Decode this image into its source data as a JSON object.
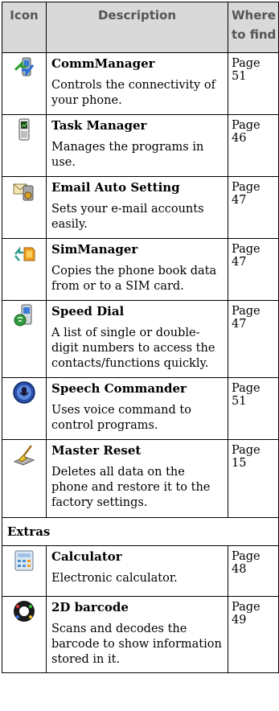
{
  "header": {
    "icon": "Icon",
    "description": "Description",
    "where": "Where to find"
  },
  "rows": [
    {
      "title": "CommManager",
      "desc": "Controls the connectivity of your phone.",
      "page": "Page 51",
      "icon": "comm-manager-icon"
    },
    {
      "title": "Task Manager",
      "desc": "Manages the programs in use.",
      "page": "Page 46",
      "icon": "task-manager-icon"
    },
    {
      "title": "Email Auto Setting",
      "desc": "Sets your e-mail accounts easily.",
      "page": "Page 47",
      "icon": "email-auto-setting-icon"
    },
    {
      "title": "SimManager",
      "desc": "Copies the phone book data from or to a SIM card.",
      "page": "Page 47",
      "icon": "sim-manager-icon"
    },
    {
      "title": "Speed Dial",
      "desc": "A list of single or double-digit numbers to access the contacts/functions quickly.",
      "page": "Page 47",
      "icon": "speed-dial-icon"
    },
    {
      "title": "Speech Commander",
      "desc": "Uses voice command to control programs.",
      "page": "Page 51",
      "icon": "speech-commander-icon"
    },
    {
      "title": "Master Reset",
      "desc": "Deletes all data on the phone and restore it to the factory settings.",
      "page": "Page 15",
      "icon": "master-reset-icon"
    }
  ],
  "section": "Extras",
  "extras": [
    {
      "title": "Calculator",
      "desc": "Electronic calculator.",
      "page": "Page 48",
      "icon": "calculator-icon"
    },
    {
      "title": "2D barcode",
      "desc": "Scans and decodes the barcode to show information stored in it.",
      "page": "Page 49",
      "icon": "barcode-icon"
    }
  ]
}
